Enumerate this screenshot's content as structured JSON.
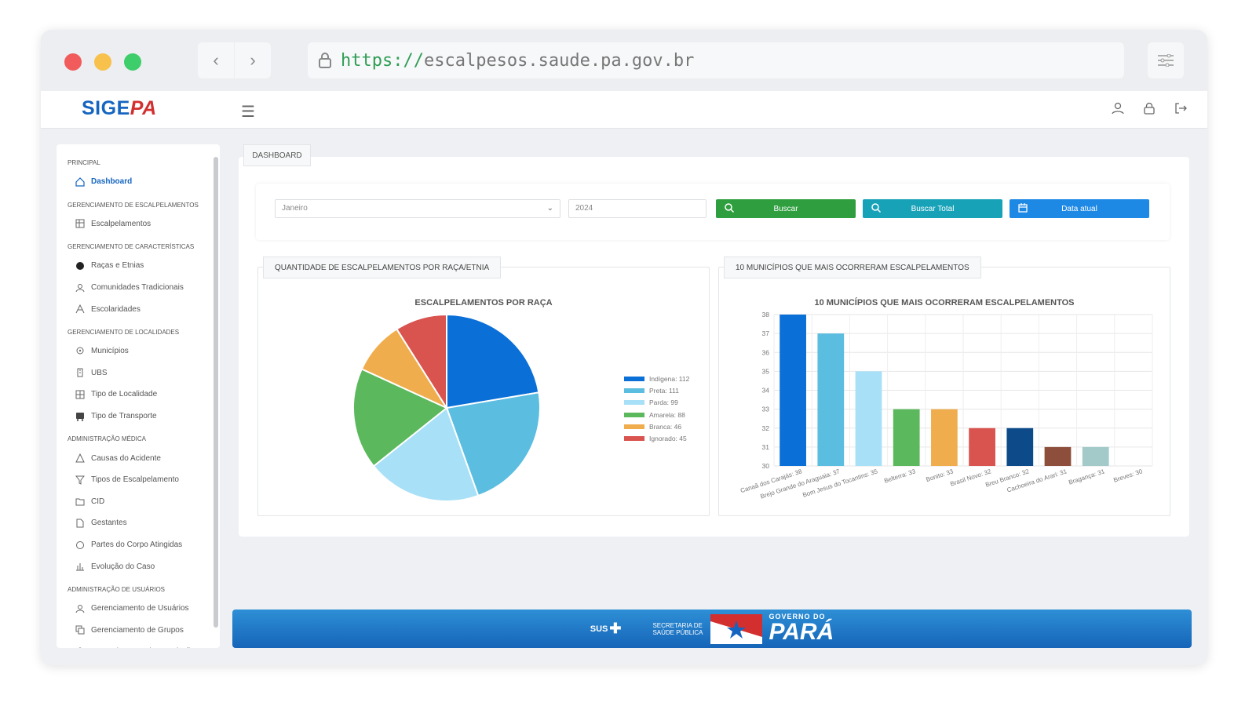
{
  "browser": {
    "url_protocol": "https://",
    "url_host": "escalpesos.saude.pa.gov.br"
  },
  "app": {
    "logo_part1": "SIGE",
    "logo_part2": "PA"
  },
  "sidebar": {
    "sections": [
      {
        "title": "PRINCIPAL",
        "items": [
          {
            "label": "Dashboard",
            "icon": "home-icon",
            "active": true
          }
        ]
      },
      {
        "title": "GERENCIAMENTO DE ESCALPELAMENTOS",
        "items": [
          {
            "label": "Escalpelamentos",
            "icon": "table-icon"
          }
        ]
      },
      {
        "title": "GERENCIAMENTO DE CARACTERÍSTICAS",
        "items": [
          {
            "label": "Raças e Etnias",
            "icon": "circle-icon"
          },
          {
            "label": "Comunidades Tradicionais",
            "icon": "people-icon"
          },
          {
            "label": "Escolaridades",
            "icon": "education-icon"
          }
        ]
      },
      {
        "title": "GERENCIAMENTO DE LOCALIDADES",
        "items": [
          {
            "label": "Municípios",
            "icon": "map-pin-icon"
          },
          {
            "label": "UBS",
            "icon": "building-icon"
          },
          {
            "label": "Tipo de Localidade",
            "icon": "grid-icon"
          },
          {
            "label": "Tipo de Transporte",
            "icon": "bus-icon"
          }
        ]
      },
      {
        "title": "ADMINISTRAÇÃO MÉDICA",
        "items": [
          {
            "label": "Causas do Acidente",
            "icon": "warning-icon"
          },
          {
            "label": "Tipos de Escalpelamento",
            "icon": "filter-icon"
          },
          {
            "label": "CID",
            "icon": "folder-icon"
          },
          {
            "label": "Gestantes",
            "icon": "file-icon"
          },
          {
            "label": "Partes do Corpo Atingidas",
            "icon": "ring-icon"
          },
          {
            "label": "Evolução do Caso",
            "icon": "bar-chart-icon"
          }
        ]
      },
      {
        "title": "ADMINISTRAÇÃO DE USUÁRIOS",
        "items": [
          {
            "label": "Gerenciamento de Usuários",
            "icon": "users-icon"
          },
          {
            "label": "Gerenciamento de Grupos",
            "icon": "copy-icon"
          },
          {
            "label": "Gerenciamento de Permissões",
            "icon": "lock-icon"
          }
        ]
      }
    ]
  },
  "main": {
    "tab": "DASHBOARD",
    "filters": {
      "month": "Janeiro",
      "year": "2024",
      "buscar": "Buscar",
      "buscar_total": "Buscar Total",
      "data_atual": "Data atual"
    },
    "card1_tab": "QUANTIDADE DE ESCALPELAMENTOS POR RAÇA/ETNIA",
    "card2_tab": "10 MUNICÍPIOS QUE MAIS OCORRERAM ESCALPELAMENTOS"
  },
  "colors": {
    "green": "#2e9e3f",
    "teal": "#17a2b8",
    "blue": "#1e88e5",
    "brand_blue": "#1565c0",
    "brand_red": "#d32f2f"
  },
  "chart_data": [
    {
      "type": "pie",
      "title": "ESCALPELAMENTOS POR RAÇA",
      "legend_position": "right",
      "slices": [
        {
          "label": "Indígena: 112",
          "value": 112,
          "color": "#0a6fd6"
        },
        {
          "label": "Preta: 111",
          "value": 111,
          "color": "#5bbde0"
        },
        {
          "label": "Parda: 99",
          "value": 99,
          "color": "#a8e0f7"
        },
        {
          "label": "Amarela: 88",
          "value": 88,
          "color": "#5cb85c"
        },
        {
          "label": "Branca: 46",
          "value": 46,
          "color": "#f0ad4e"
        },
        {
          "label": "Ignorado: 45",
          "value": 45,
          "color": "#d9534f"
        }
      ]
    },
    {
      "type": "bar",
      "title": "10 MUNICÍPIOS QUE MAIS OCORRERAM ESCALPELAMENTOS",
      "ylim": [
        30,
        38
      ],
      "yticks": [
        30,
        31,
        32,
        33,
        34,
        35,
        36,
        37,
        38
      ],
      "grid": true,
      "categories": [
        "Canaã dos Carajás: 38",
        "Brejo Grande do Araguaia: 37",
        "Bom Jesus do Tocantins: 35",
        "Belterra: 33",
        "Bonito: 33",
        "Brasil Novo: 32",
        "Breu Branco: 32",
        "Cachoeira do Arari: 31",
        "Bragança: 31",
        "Breves: 30"
      ],
      "values": [
        38,
        37,
        35,
        33,
        33,
        32,
        32,
        31,
        31,
        30
      ],
      "colors": [
        "#0a6fd6",
        "#5bbde0",
        "#a8e0f7",
        "#5cb85c",
        "#f0ad4e",
        "#d9534f",
        "#0d4a8a",
        "#8d4f3c",
        "#a3c9c9",
        "#cccccc"
      ]
    }
  ],
  "footer": {
    "sus": "SUS",
    "secretaria_line1": "SECRETARIA DE",
    "secretaria_line2": "SAÚDE PÚBLICA",
    "governo": "GOVERNO DO",
    "para": "PARÁ"
  }
}
